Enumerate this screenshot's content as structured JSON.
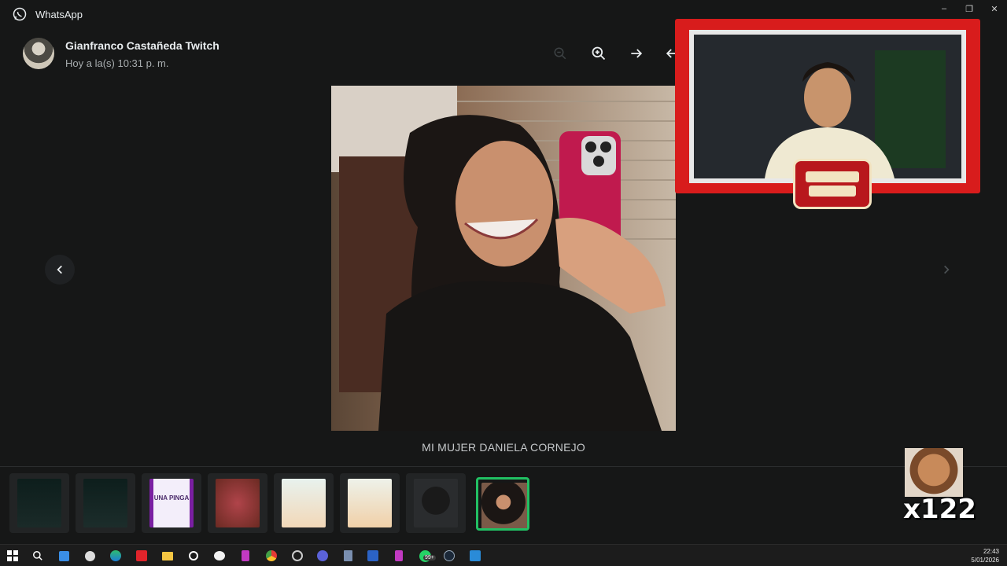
{
  "window": {
    "title": "WhatsApp",
    "controls": [
      "minimize",
      "restore",
      "close"
    ]
  },
  "header": {
    "sender_name": "Gianfranco Castañeda Twitch",
    "timestamp": "Hoy a la(s) 10:31 p. m.",
    "actions": [
      "zoom-out-icon",
      "zoom-in-icon",
      "forward-icon",
      "reply-icon"
    ]
  },
  "viewer": {
    "caption": "MI MUJER DANIELA CORNEJO"
  },
  "thumbnails": [
    {
      "kind": "chat-screenshot"
    },
    {
      "kind": "chat-screenshot"
    },
    {
      "kind": "flyer",
      "text": "UNA PINGA"
    },
    {
      "kind": "photo"
    },
    {
      "kind": "flyer"
    },
    {
      "kind": "flyer"
    },
    {
      "kind": "photo"
    },
    {
      "kind": "photo",
      "selected": true
    }
  ],
  "overlay": {
    "counter": "x122"
  },
  "taskbar": {
    "time": "22:43",
    "date": "5/01/2026",
    "notification_badge": "99+"
  },
  "colors": {
    "accent": "#21c063",
    "background": "#161717",
    "stream_frame": "#d81c1c"
  }
}
